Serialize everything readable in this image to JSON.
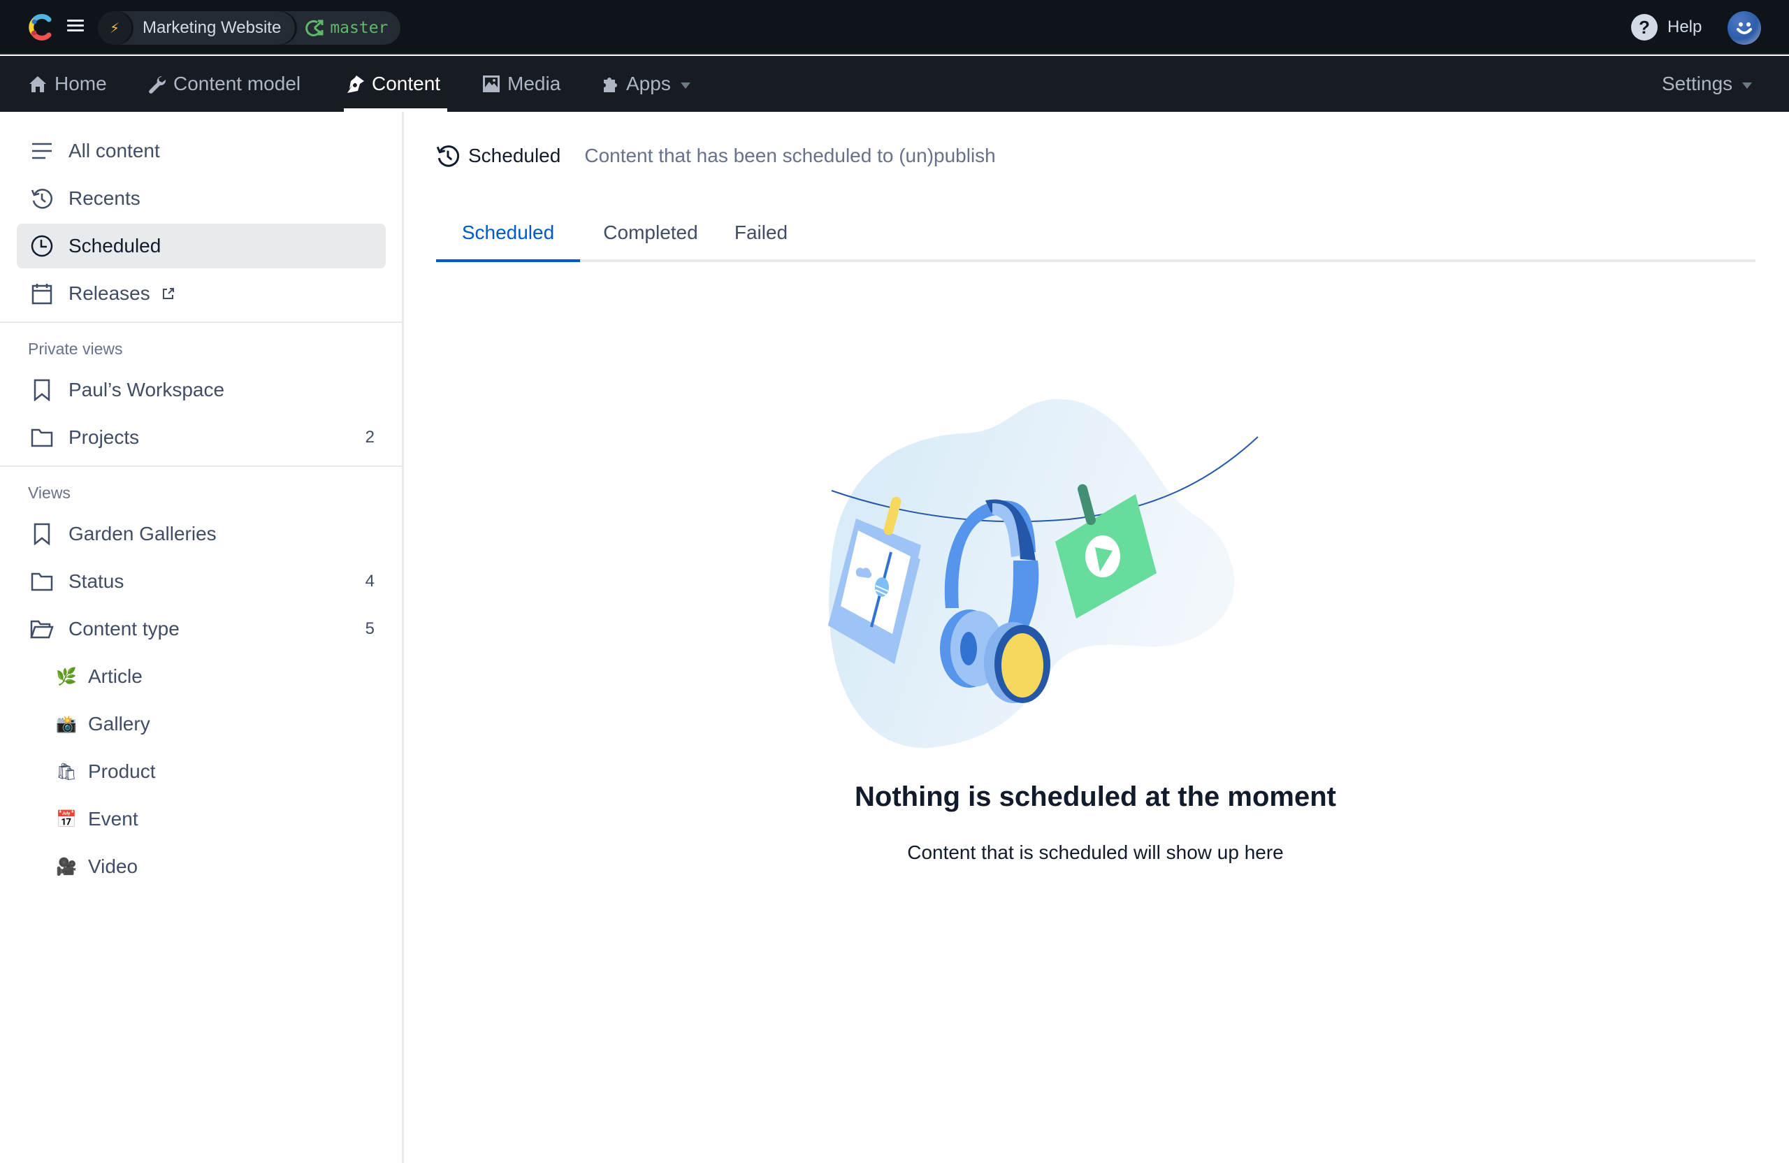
{
  "topbar": {
    "space_name": "Marketing Website",
    "space_icon": "lightning-bolt",
    "environment": "master",
    "help_label": "Help"
  },
  "nav": {
    "items": [
      {
        "label": "Home",
        "icon": "home-icon"
      },
      {
        "label": "Content model",
        "icon": "wrench-icon"
      },
      {
        "label": "Content",
        "icon": "pen-nib-icon",
        "active": true
      },
      {
        "label": "Media",
        "icon": "image-icon"
      },
      {
        "label": "Apps",
        "icon": "puzzle-icon",
        "has_dropdown": true
      }
    ],
    "settings_label": "Settings"
  },
  "sidebar": {
    "items": [
      {
        "label": "All content",
        "icon": "list-icon"
      },
      {
        "label": "Recents",
        "icon": "history-icon"
      },
      {
        "label": "Scheduled",
        "icon": "clock-icon",
        "active": true
      },
      {
        "label": "Releases",
        "icon": "calendar-icon",
        "external": true
      }
    ],
    "private_views": {
      "heading": "Private views",
      "items": [
        {
          "label": "Paul’s Workspace",
          "icon": "bookmark-icon"
        },
        {
          "label": "Projects",
          "icon": "folder-icon",
          "count": "2"
        }
      ]
    },
    "views": {
      "heading": "Views",
      "items": [
        {
          "label": "Garden Galleries",
          "icon": "bookmark-icon"
        },
        {
          "label": "Status",
          "icon": "folder-icon",
          "count": "4"
        },
        {
          "label": "Content type",
          "icon": "folder-open-icon",
          "count": "5"
        }
      ],
      "content_types": [
        {
          "label": "Article",
          "emoji": "🌿"
        },
        {
          "label": "Gallery",
          "emoji": "📸"
        },
        {
          "label": "Product",
          "emoji": "🛍"
        },
        {
          "label": "Event",
          "emoji": "📅"
        },
        {
          "label": "Video",
          "emoji": "🎥"
        }
      ]
    }
  },
  "main": {
    "title": "Scheduled",
    "description": "Content that has been scheduled to (un)publish",
    "tabs": [
      {
        "label": "Scheduled",
        "active": true
      },
      {
        "label": "Completed"
      },
      {
        "label": "Failed"
      }
    ],
    "empty_state": {
      "heading": "Nothing is scheduled at the moment",
      "subtext": "Content that is scheduled will show up here"
    }
  },
  "colors": {
    "topbar_bg": "#0f141b",
    "navbar_bg": "#171b22",
    "accent_blue": "#0059c8",
    "env_green": "#5fb86b",
    "active_item_bg": "#e7ebee"
  }
}
